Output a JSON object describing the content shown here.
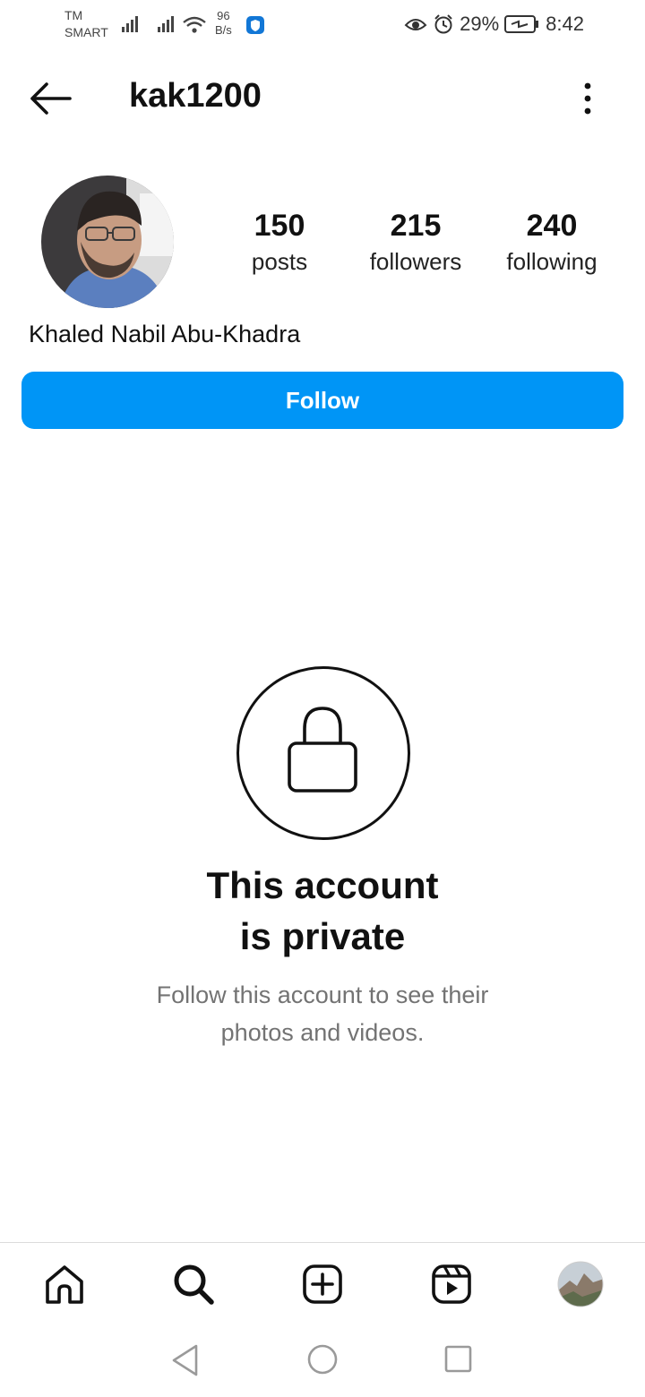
{
  "status_bar": {
    "carrier_line1": "TM",
    "carrier_line2": "SMART",
    "net_speed_value": "96",
    "net_speed_unit": "B/s",
    "battery": "29%",
    "time": "8:42"
  },
  "header": {
    "username": "kak1200"
  },
  "profile": {
    "stats": [
      {
        "value": "150",
        "label": "posts"
      },
      {
        "value": "215",
        "label": "followers"
      },
      {
        "value": "240",
        "label": "following"
      }
    ],
    "full_name": "Khaled Nabil Abu-Khadra",
    "follow_label": "Follow"
  },
  "private_notice": {
    "title_line1": "This account",
    "title_line2": "is private",
    "subtitle_line1": "Follow this account to see their",
    "subtitle_line2": "photos and videos."
  },
  "colors": {
    "accent": "#0095f6",
    "muted_text": "#737373"
  }
}
